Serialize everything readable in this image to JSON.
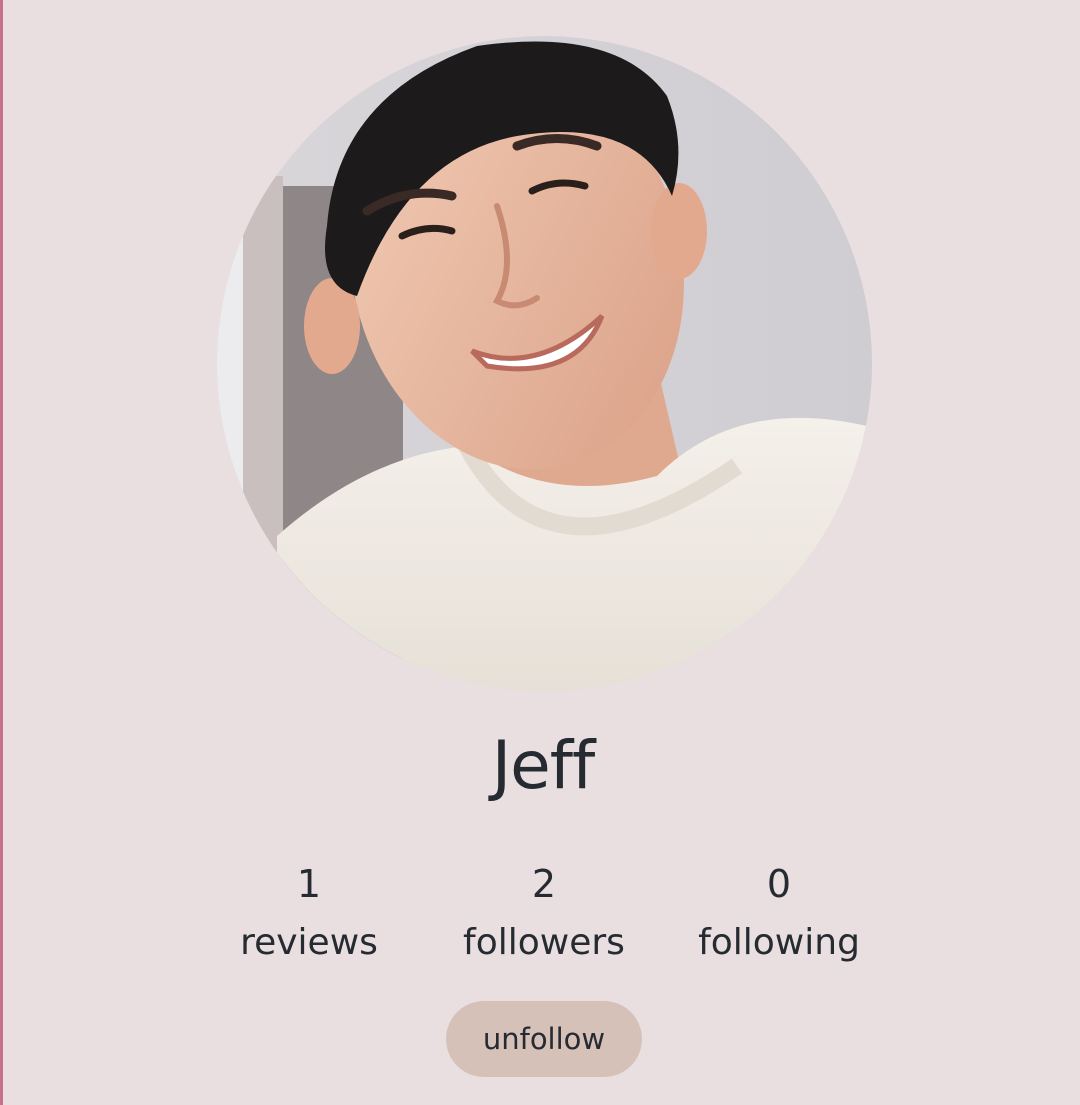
{
  "profile": {
    "name": "Jeff",
    "avatar_icon": "profile-photo"
  },
  "stats": {
    "reviews": {
      "count": "1",
      "label": "reviews"
    },
    "followers": {
      "count": "2",
      "label": "followers"
    },
    "following": {
      "count": "0",
      "label": "following"
    }
  },
  "actions": {
    "unfollow_label": "unfollow"
  },
  "colors": {
    "background": "#e9dfe0",
    "button": "#d5c1b8",
    "text": "#262a31",
    "accent_border": "#c96f8c"
  }
}
